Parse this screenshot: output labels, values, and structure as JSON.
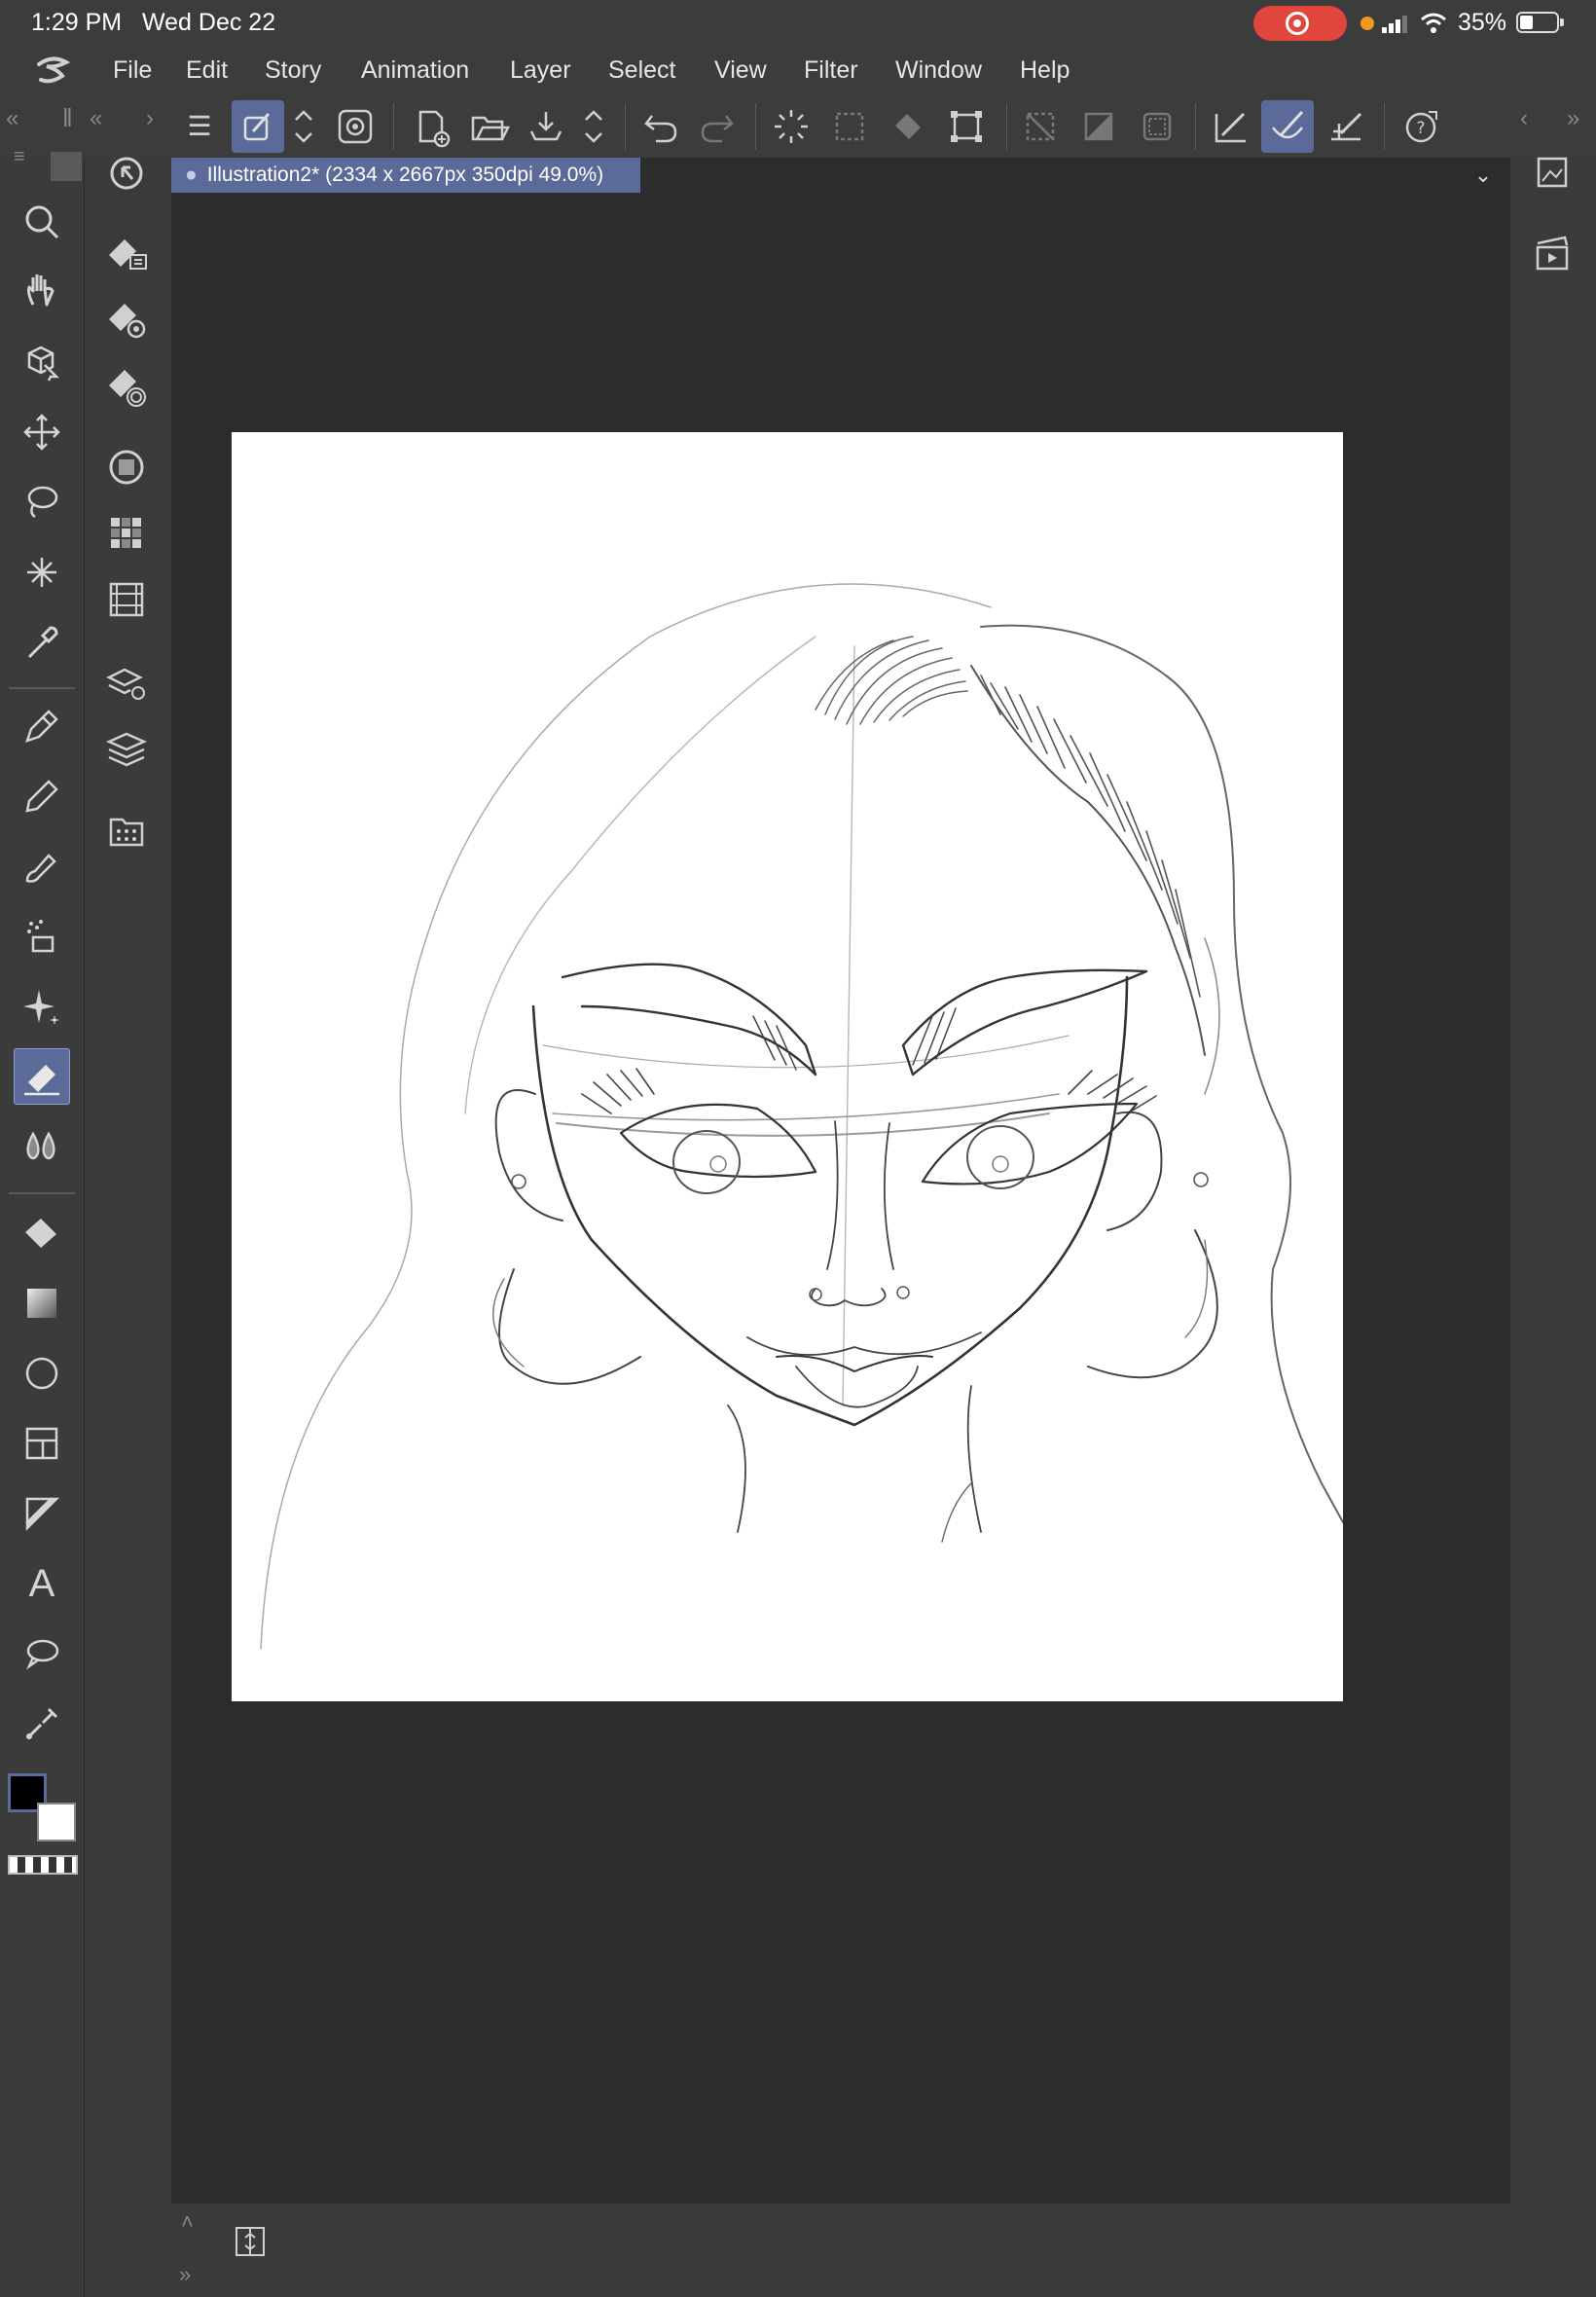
{
  "status_bar": {
    "time": "1:29 PM",
    "date": "Wed Dec 22",
    "battery_percent": "35%",
    "battery_level": 0.35,
    "recording": true
  },
  "menu": {
    "items": [
      "File",
      "Edit",
      "Story",
      "Animation",
      "Layer",
      "Select",
      "View",
      "Filter",
      "Window",
      "Help"
    ]
  },
  "document": {
    "tab_label": "Illustration2* (2334 x 2667px 350dpi 49.0%)"
  },
  "colors": {
    "accent": "#5b6a99",
    "panel_bg": "#3b3b3b",
    "canvas_bg": "#2c2c2c",
    "paper": "#ffffff",
    "foreground_color": "#000000",
    "background_color": "#ffffff"
  },
  "toolbar": {
    "active_tool": "eraser",
    "tools": [
      "zoom",
      "hand",
      "object",
      "move",
      "lasso-select",
      "auto-select",
      "eyedropper",
      "pen",
      "pencil",
      "brush",
      "airbrush",
      "decoration",
      "eraser",
      "blend",
      "fill",
      "gradient",
      "figure",
      "frame",
      "ruler",
      "text",
      "balloon",
      "correct-line"
    ]
  },
  "sub_toolbar": {
    "items": [
      "tool-property",
      "sub-tool",
      "sub-tool-detail",
      "brush-size",
      "color-circle",
      "color-set",
      "animation-timeline",
      "layer-property",
      "layer",
      "material"
    ]
  }
}
